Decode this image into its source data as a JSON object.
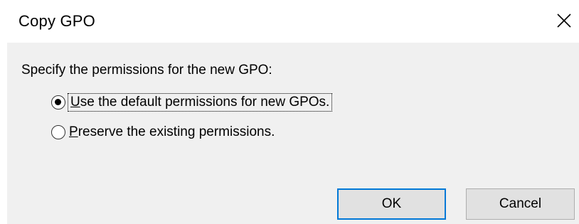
{
  "window": {
    "title": "Copy GPO"
  },
  "content": {
    "prompt": "Specify the permissions for the new GPO:",
    "options": [
      {
        "accel": "U",
        "rest": "se the default permissions for new GPOs.",
        "selected": true
      },
      {
        "accel": "P",
        "rest": "reserve the existing permissions.",
        "selected": false
      }
    ]
  },
  "buttons": {
    "ok": "OK",
    "cancel": "Cancel"
  },
  "colors": {
    "dialog_body": "#f0f0f0",
    "default_button_border": "#0078d7",
    "button_face": "#e1e1e1"
  },
  "icons": {
    "close": "close-icon"
  }
}
